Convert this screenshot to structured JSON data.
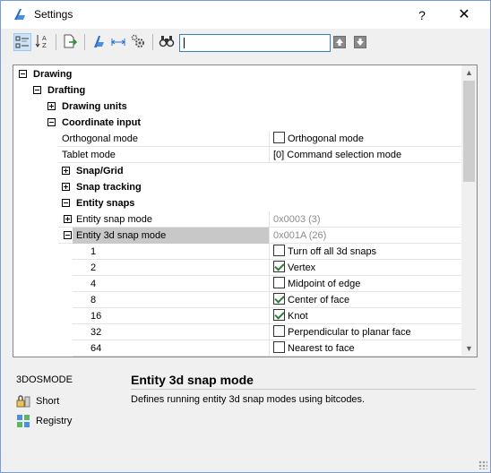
{
  "window": {
    "title": "Settings",
    "help_glyph": "?",
    "close_glyph": "✕"
  },
  "toolbar": {
    "search_value": "",
    "icons": [
      "categorized-view-icon",
      "alphabetic-view-icon",
      "export-icon",
      "drawing-variables-icon",
      "dimension-icon",
      "settings-gear-icon",
      "find-icon",
      "previous-arrow-icon",
      "next-arrow-icon"
    ]
  },
  "tree": {
    "drawing": "Drawing",
    "drafting": "Drafting",
    "drawing_units": "Drawing units",
    "coordinate_input": "Coordinate input",
    "orthogonal_mode": {
      "name": "Orthogonal mode",
      "value": "Orthogonal mode",
      "checked": false
    },
    "tablet_mode": {
      "name": "Tablet mode",
      "value": "[0] Command selection mode"
    },
    "snap_grid": "Snap/Grid",
    "snap_tracking": "Snap tracking",
    "entity_snaps": "Entity snaps",
    "entity_snap_mode": {
      "name": "Entity snap mode",
      "value": "0x0003 (3)"
    },
    "entity_3d_snap_mode": {
      "name": "Entity 3d snap mode",
      "value": "0x001A (26)"
    },
    "bits": [
      {
        "bit": "1",
        "label": "Turn off all 3d snaps",
        "checked": false
      },
      {
        "bit": "2",
        "label": "Vertex",
        "checked": true
      },
      {
        "bit": "4",
        "label": "Midpoint of edge",
        "checked": false
      },
      {
        "bit": "8",
        "label": "Center of face",
        "checked": true
      },
      {
        "bit": "16",
        "label": "Knot",
        "checked": true
      },
      {
        "bit": "32",
        "label": "Perpendicular to planar face",
        "checked": false
      },
      {
        "bit": "64",
        "label": "Nearest to face",
        "checked": false
      }
    ]
  },
  "info": {
    "variable": "3DOSMODE",
    "title": "Entity 3d snap mode",
    "description": "Defines running entity 3d snap modes using bitcodes.",
    "short_label": "Short",
    "registry_label": "Registry"
  },
  "colors": {
    "accent": "#3c7fb1",
    "selected_row": "#c8c8c8",
    "check": "#2f7d32"
  }
}
